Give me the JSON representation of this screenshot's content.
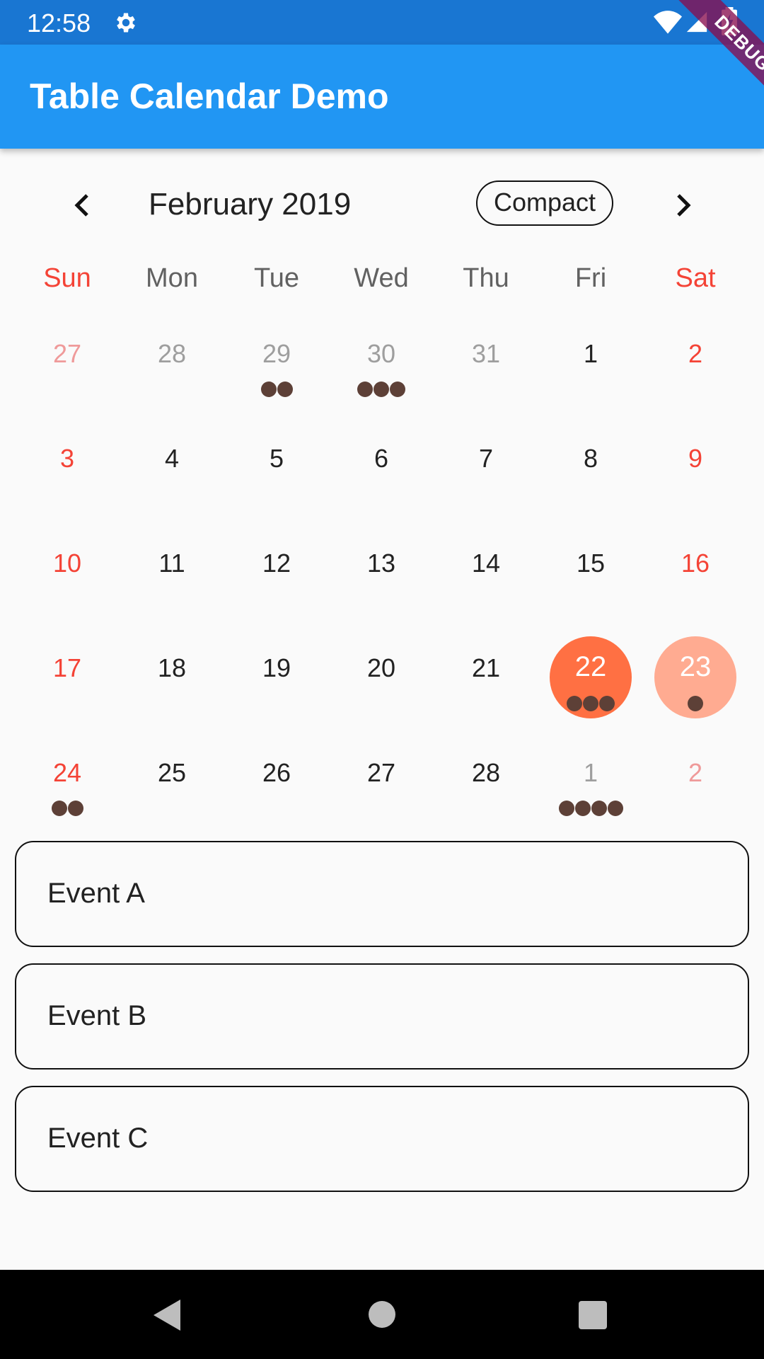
{
  "status_bar": {
    "time": "12:58",
    "icons": [
      "gear-icon",
      "wifi-icon",
      "signal-icon",
      "battery-charging-icon"
    ]
  },
  "app_bar": {
    "title": "Table Calendar Demo",
    "color": "#2196f3",
    "debug_banner": "DEBUG"
  },
  "calendar": {
    "month_title": "February 2019",
    "format_button": "Compact",
    "prev_icon": "chevron-left-icon",
    "next_icon": "chevron-right-icon",
    "days_of_week": [
      "Sun",
      "Mon",
      "Tue",
      "Wed",
      "Thu",
      "Fri",
      "Sat"
    ],
    "weekend_color": "#f44336",
    "selected_color": "#ff7043",
    "today_color": "#ffab91",
    "marker_color": "#5d4037",
    "weeks": [
      [
        {
          "day": "27",
          "outside": true,
          "weekend": true,
          "markers": 0
        },
        {
          "day": "28",
          "outside": true,
          "markers": 0
        },
        {
          "day": "29",
          "outside": true,
          "markers": 2
        },
        {
          "day": "30",
          "outside": true,
          "markers": 3
        },
        {
          "day": "31",
          "outside": true,
          "markers": 0
        },
        {
          "day": "1",
          "markers": 0
        },
        {
          "day": "2",
          "weekend": true,
          "markers": 0
        }
      ],
      [
        {
          "day": "3",
          "weekend": true,
          "markers": 0
        },
        {
          "day": "4",
          "markers": 0
        },
        {
          "day": "5",
          "markers": 0
        },
        {
          "day": "6",
          "markers": 0
        },
        {
          "day": "7",
          "markers": 0
        },
        {
          "day": "8",
          "markers": 0
        },
        {
          "day": "9",
          "weekend": true,
          "markers": 0
        }
      ],
      [
        {
          "day": "10",
          "weekend": true,
          "markers": 0
        },
        {
          "day": "11",
          "markers": 0
        },
        {
          "day": "12",
          "markers": 0
        },
        {
          "day": "13",
          "markers": 0
        },
        {
          "day": "14",
          "markers": 0
        },
        {
          "day": "15",
          "markers": 0
        },
        {
          "day": "16",
          "weekend": true,
          "markers": 0
        }
      ],
      [
        {
          "day": "17",
          "weekend": true,
          "markers": 0
        },
        {
          "day": "18",
          "markers": 0
        },
        {
          "day": "19",
          "markers": 0
        },
        {
          "day": "20",
          "markers": 0
        },
        {
          "day": "21",
          "markers": 0
        },
        {
          "day": "22",
          "selected": true,
          "markers": 3
        },
        {
          "day": "23",
          "weekend": true,
          "today": true,
          "markers": 1
        }
      ],
      [
        {
          "day": "24",
          "weekend": true,
          "markers": 2
        },
        {
          "day": "25",
          "markers": 0
        },
        {
          "day": "26",
          "markers": 0
        },
        {
          "day": "27",
          "markers": 0
        },
        {
          "day": "28",
          "markers": 0
        },
        {
          "day": "1",
          "outside": true,
          "markers": 4
        },
        {
          "day": "2",
          "outside": true,
          "weekend": true,
          "markers": 0
        }
      ]
    ]
  },
  "events": [
    {
      "label": "Event A"
    },
    {
      "label": "Event B"
    },
    {
      "label": "Event C"
    }
  ],
  "nav_bar": {
    "icons": [
      "back-icon",
      "home-icon",
      "recents-icon"
    ]
  }
}
